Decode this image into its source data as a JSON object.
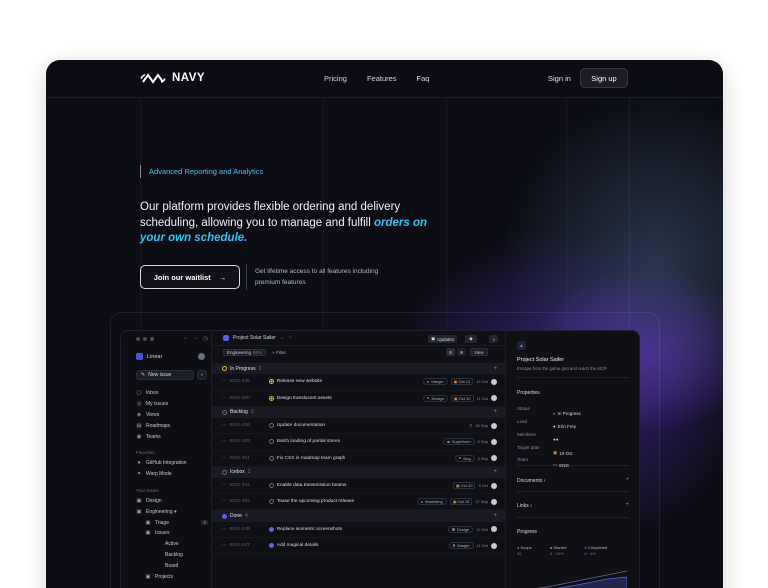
{
  "nav": {
    "logo": "NAVY",
    "links": [
      "Pricing",
      "Features",
      "Faq"
    ],
    "sign_in": "Sign in",
    "sign_up": "Sign up"
  },
  "hero": {
    "tagline": "Advanced Reporting and Analytics",
    "headline": "Our platform provides flexible ordering and delivery scheduling, allowing you to manage and fulfill",
    "headline_highlight": "orders on your own schedule.",
    "cta": "Join our waitlist",
    "cta_arrow": "→",
    "cta_note": "Get lifetime access to all features including premium features"
  },
  "app": {
    "workspace": "Linear",
    "new_issue": "New issue",
    "sidebar": {
      "main": [
        {
          "icon": "inbox-icon",
          "glyph": "▢",
          "label": "Inbox"
        },
        {
          "icon": "my-issues-icon",
          "glyph": "◎",
          "label": "My issues"
        },
        {
          "icon": "views-icon",
          "glyph": "◈",
          "label": "Views"
        },
        {
          "icon": "roadmaps-icon",
          "glyph": "▤",
          "label": "Roadmaps"
        },
        {
          "icon": "teams-icon",
          "glyph": "◉",
          "label": "Teams"
        }
      ],
      "favorites_heading": "Favorites",
      "favorites": [
        {
          "icon": "github-icon",
          "glyph": "●",
          "label": "GitHub Integration"
        },
        {
          "icon": "warp-icon",
          "glyph": "✦",
          "label": "Warp Mode"
        }
      ],
      "teams_heading": "Your teams",
      "teams": [
        {
          "label": "Design",
          "level": 0
        },
        {
          "label": "Engineering ▾",
          "level": 0
        },
        {
          "label": "Triage",
          "level": 1,
          "count": "2"
        },
        {
          "label": "Issues",
          "level": 1
        },
        {
          "label": "Active",
          "level": 2
        },
        {
          "label": "Backlog",
          "level": 2
        },
        {
          "label": "Board",
          "level": 2
        },
        {
          "label": "Projects",
          "level": 1
        }
      ]
    },
    "main": {
      "project": "Project Solar Sailer",
      "updates": "Updates",
      "filter_team": "Engineering",
      "filter_pct": "85%",
      "filter": "Filter",
      "view": "View",
      "groups": [
        {
          "name": "In Progress",
          "count": "2",
          "status": "prog",
          "rows": [
            {
              "id": "ENG-248",
              "title": "Release new website",
              "tag": "Margin",
              "date": "Oct 12",
              "meta": "12 Oct"
            },
            {
              "id": "ENG-250",
              "title": "Design translucent assets",
              "tag": "Design",
              "date": "Oct 12",
              "meta": "11 Oct"
            }
          ]
        },
        {
          "name": "Backlog",
          "count": "3",
          "status": "todo",
          "rows": [
            {
              "id": "ENG-028",
              "title": "Update documentation",
              "tag": "",
              "date": "",
              "meta": "30 Sep"
            },
            {
              "id": "ENG-108",
              "title": "Batch loading of partial stores",
              "tag": "Superform",
              "date": "",
              "meta": "5 Sep"
            },
            {
              "id": "ENG-201",
              "title": "Fix CSS in roadmap team graph",
              "tag": "Bug",
              "date": "",
              "meta": "3 Sep"
            }
          ]
        },
        {
          "name": "Icebox",
          "count": "2",
          "status": "todo",
          "rows": [
            {
              "id": "ENG-344",
              "title": "Enable data transmission beams",
              "tag": "",
              "date": "Oct 20",
              "meta": "9 Oct"
            },
            {
              "id": "ENG-402",
              "title": "Tease the upcoming product release",
              "tag": "Marketing",
              "date": "Oct 19",
              "meta": "27 Sep"
            }
          ]
        },
        {
          "name": "Done",
          "count": "4",
          "status": "done",
          "rows": [
            {
              "id": "ENG-249",
              "title": "Replace isometric screenshots",
              "tag": "Design",
              "date": "",
              "meta": "12 Oct"
            },
            {
              "id": "ENG-247",
              "title": "Add magical details",
              "tag": "Margin",
              "date": "",
              "meta": "11 Oct"
            }
          ]
        }
      ]
    },
    "detail": {
      "title": "Project Solar Sailer",
      "desc": "Escape from the game grid and reach the MCP",
      "properties_heading": "Properties",
      "props": [
        {
          "label": "Status",
          "value": "In Progress"
        },
        {
          "label": "Lead",
          "value": "Erin Frey"
        },
        {
          "label": "Members",
          "value": ""
        },
        {
          "label": "Target date",
          "value": "10 Oct"
        },
        {
          "label": "Team",
          "value": "ENG"
        }
      ],
      "documents": "Documents",
      "links": "Links",
      "progress": "Progress",
      "legend": [
        {
          "label": "Scope",
          "value": "36"
        },
        {
          "label": "Started",
          "value": "6 · 18%"
        },
        {
          "label": "Completed",
          "value": "6 · 6%"
        }
      ]
    }
  },
  "colors": {
    "accent": "#2ec3f0",
    "tagline": "#56c2e6",
    "purple_glow": "#6034dc",
    "background": "#0c0d14"
  }
}
